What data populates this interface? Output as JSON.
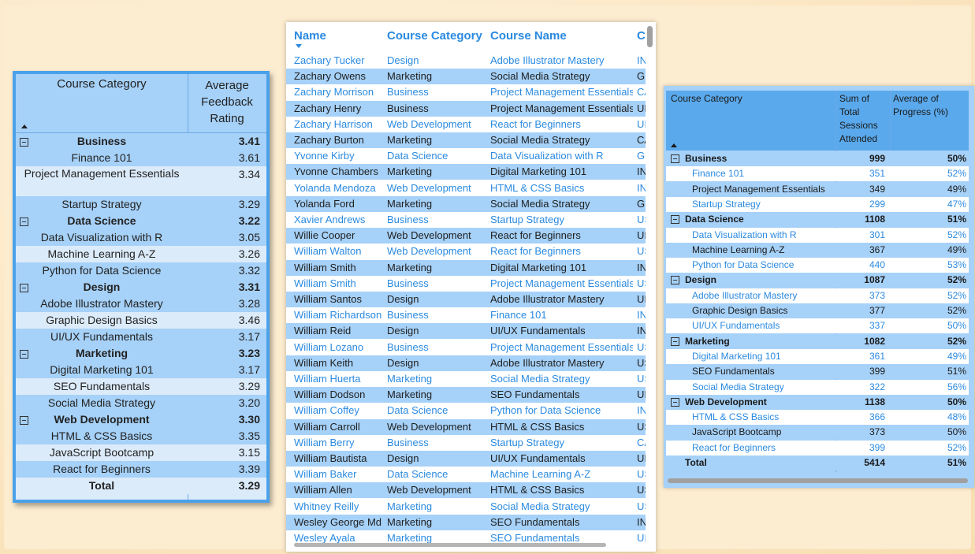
{
  "left_matrix": {
    "header_category": "Course Category",
    "header_value": "Average Feedback Rating",
    "rows": [
      {
        "type": "group",
        "label": "Business",
        "value": "3.41"
      },
      {
        "type": "item",
        "label": "Finance 101",
        "value": "3.61"
      },
      {
        "type": "item",
        "label": "Project Management Essentials",
        "value": "3.34"
      },
      {
        "type": "item",
        "label": "Startup Strategy",
        "value": "3.29"
      },
      {
        "type": "group",
        "label": "Data Science",
        "value": "3.22"
      },
      {
        "type": "item",
        "label": "Data Visualization with R",
        "value": "3.05"
      },
      {
        "type": "item",
        "label": "Machine Learning A-Z",
        "value": "3.26"
      },
      {
        "type": "item",
        "label": "Python for Data Science",
        "value": "3.32"
      },
      {
        "type": "group",
        "label": "Design",
        "value": "3.31"
      },
      {
        "type": "item",
        "label": "Adobe Illustrator Mastery",
        "value": "3.28"
      },
      {
        "type": "item",
        "label": "Graphic Design Basics",
        "value": "3.46"
      },
      {
        "type": "item",
        "label": "UI/UX Fundamentals",
        "value": "3.17"
      },
      {
        "type": "group",
        "label": "Marketing",
        "value": "3.23"
      },
      {
        "type": "item",
        "label": "Digital Marketing 101",
        "value": "3.17"
      },
      {
        "type": "item",
        "label": "SEO Fundamentals",
        "value": "3.29"
      },
      {
        "type": "item",
        "label": "Social Media Strategy",
        "value": "3.20"
      },
      {
        "type": "group",
        "label": "Web Development",
        "value": "3.30"
      },
      {
        "type": "item",
        "label": "HTML & CSS Basics",
        "value": "3.35"
      },
      {
        "type": "item",
        "label": "JavaScript Bootcamp",
        "value": "3.15"
      },
      {
        "type": "item",
        "label": "React for Beginners",
        "value": "3.39"
      },
      {
        "type": "total",
        "label": "Total",
        "value": "3.29"
      }
    ]
  },
  "mid_table": {
    "headers": [
      "Name",
      "Course Category",
      "Course Name",
      "C"
    ],
    "rows": [
      [
        "Zachary Tucker",
        "Design",
        "Adobe Illustrator Mastery",
        "IN"
      ],
      [
        "Zachary Owens",
        "Marketing",
        "Social Media Strategy",
        "GI"
      ],
      [
        "Zachary Morrison",
        "Business",
        "Project Management Essentials",
        "CA"
      ],
      [
        "Zachary Henry",
        "Business",
        "Project Management Essentials",
        "UI"
      ],
      [
        "Zachary Harrison",
        "Web Development",
        "React for Beginners",
        "UI"
      ],
      [
        "Zachary Burton",
        "Marketing",
        "Social Media Strategy",
        "CA"
      ],
      [
        "Yvonne Kirby",
        "Data Science",
        "Data Visualization with R",
        "GI"
      ],
      [
        "Yvonne Chambers",
        "Marketing",
        "Digital Marketing 101",
        "IN"
      ],
      [
        "Yolanda Mendoza",
        "Web Development",
        "HTML & CSS Basics",
        "IN"
      ],
      [
        "Yolanda Ford",
        "Marketing",
        "Social Media Strategy",
        "GI"
      ],
      [
        "Xavier Andrews",
        "Business",
        "Startup Strategy",
        "US"
      ],
      [
        "Willie Cooper",
        "Web Development",
        "React for Beginners",
        "UI"
      ],
      [
        "William Walton",
        "Web Development",
        "React for Beginners",
        "US"
      ],
      [
        "William Smith",
        "Marketing",
        "Digital Marketing 101",
        "IN"
      ],
      [
        "William Smith",
        "Business",
        "Project Management Essentials",
        "US"
      ],
      [
        "William Santos",
        "Design",
        "Adobe Illustrator Mastery",
        "UI"
      ],
      [
        "William Richardson",
        "Business",
        "Finance 101",
        "IN"
      ],
      [
        "William Reid",
        "Design",
        "UI/UX Fundamentals",
        "IN"
      ],
      [
        "William Lozano",
        "Business",
        "Project Management Essentials",
        "US"
      ],
      [
        "William Keith",
        "Design",
        "Adobe Illustrator Mastery",
        "US"
      ],
      [
        "William Huerta",
        "Marketing",
        "Social Media Strategy",
        "US"
      ],
      [
        "William Dodson",
        "Marketing",
        "SEO Fundamentals",
        "UI"
      ],
      [
        "William Coffey",
        "Data Science",
        "Python for Data Science",
        "IN"
      ],
      [
        "William Carroll",
        "Web Development",
        "HTML & CSS Basics",
        "US"
      ],
      [
        "William Berry",
        "Business",
        "Startup Strategy",
        "CA"
      ],
      [
        "William Bautista",
        "Design",
        "UI/UX Fundamentals",
        "UI"
      ],
      [
        "William Baker",
        "Data Science",
        "Machine Learning A-Z",
        "US"
      ],
      [
        "William Allen",
        "Web Development",
        "HTML & CSS Basics",
        "US"
      ],
      [
        "Whitney Reilly",
        "Marketing",
        "Social Media Strategy",
        "US"
      ],
      [
        "Wesley George Md",
        "Marketing",
        "SEO Fundamentals",
        "IN"
      ],
      [
        "Wesley Ayala",
        "Marketing",
        "SEO Fundamentals",
        "UI"
      ]
    ]
  },
  "right_matrix": {
    "header_category": "Course Category",
    "header_sum": "Sum of Total Sessions Attended",
    "header_avg": "Average of Progress (%)",
    "rows": [
      {
        "type": "group",
        "label": "Business",
        "sum": "999",
        "avg": "50%"
      },
      {
        "type": "item",
        "label": "Finance 101",
        "sum": "351",
        "avg": "52%"
      },
      {
        "type": "item",
        "label": "Project Management Essentials",
        "sum": "349",
        "avg": "49%"
      },
      {
        "type": "item",
        "label": "Startup Strategy",
        "sum": "299",
        "avg": "47%"
      },
      {
        "type": "group",
        "label": "Data Science",
        "sum": "1108",
        "avg": "51%"
      },
      {
        "type": "item",
        "label": "Data Visualization with R",
        "sum": "301",
        "avg": "52%"
      },
      {
        "type": "item",
        "label": "Machine Learning A-Z",
        "sum": "367",
        "avg": "49%"
      },
      {
        "type": "item",
        "label": "Python for Data Science",
        "sum": "440",
        "avg": "53%"
      },
      {
        "type": "group",
        "label": "Design",
        "sum": "1087",
        "avg": "52%"
      },
      {
        "type": "item",
        "label": "Adobe Illustrator Mastery",
        "sum": "373",
        "avg": "52%"
      },
      {
        "type": "item",
        "label": "Graphic Design Basics",
        "sum": "377",
        "avg": "52%"
      },
      {
        "type": "item",
        "label": "UI/UX Fundamentals",
        "sum": "337",
        "avg": "50%"
      },
      {
        "type": "group",
        "label": "Marketing",
        "sum": "1082",
        "avg": "52%"
      },
      {
        "type": "item",
        "label": "Digital Marketing 101",
        "sum": "361",
        "avg": "49%"
      },
      {
        "type": "item",
        "label": "SEO Fundamentals",
        "sum": "399",
        "avg": "51%"
      },
      {
        "type": "item",
        "label": "Social Media Strategy",
        "sum": "322",
        "avg": "56%"
      },
      {
        "type": "group",
        "label": "Web Development",
        "sum": "1138",
        "avg": "50%"
      },
      {
        "type": "item",
        "label": "HTML & CSS Basics",
        "sum": "366",
        "avg": "48%"
      },
      {
        "type": "item",
        "label": "JavaScript Bootcamp",
        "sum": "373",
        "avg": "50%"
      },
      {
        "type": "item",
        "label": "React for Beginners",
        "sum": "399",
        "avg": "52%"
      },
      {
        "type": "total",
        "label": "Total",
        "sum": "5414",
        "avg": "51%"
      }
    ]
  },
  "colors": {
    "accent_blue": "#2a8ae0",
    "row_blue": "#a6d1f8",
    "header_blue": "#5aa9ec",
    "frame_blue": "#4aa1ea",
    "background": "#fbe8c6"
  }
}
